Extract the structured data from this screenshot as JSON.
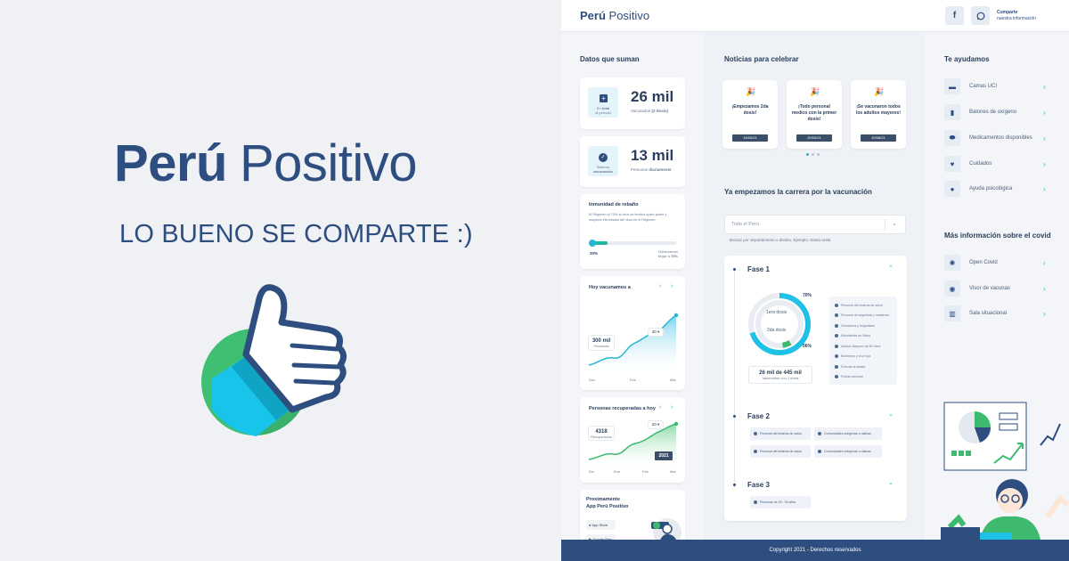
{
  "hero": {
    "title_bold": "Perú",
    "title_light": "Positivo",
    "subtitle": "LO BUENO SE COMPARTE :)"
  },
  "header": {
    "brand_bold": "Perú",
    "brand_light": "Positivo",
    "facebook_icon": "f",
    "share_line1": "Comparte",
    "share_line2": "nuestra información"
  },
  "datos": {
    "heading": "Datos que suman",
    "card1": {
      "icon_label_a": "En",
      "icon_label_b": "total",
      "icon_label_c": "al periodo",
      "number": "26 mil",
      "desc_a": "Vacunados",
      "desc_b": "(2 dosis)"
    },
    "card2": {
      "icon_label_a": "Sistema",
      "icon_label_b": "vacunación",
      "number": "13 mil",
      "desc_a": "Personas",
      "desc_b": "diariamente"
    },
    "immunity": {
      "title": "Inmunidad de rebaño",
      "text": "El Régimen al 70% al virus se tendría quien pobre y mayores efectividad del virus en el Régimen",
      "start": "20%",
      "goal_label": "Deberíamos llegar a",
      "goal": "70%",
      "progress": 0.2
    },
    "vacunados": {
      "title": "Hoy vacunamos a",
      "value": "300 mil",
      "value_label": "Personas",
      "tooltip": "30",
      "x": [
        "Dec",
        "Feb",
        "Mar"
      ]
    },
    "recuperados": {
      "title": "Personas recuperadas a hoy",
      "value": "4318",
      "value_label": "Recuperados",
      "tooltip": "20",
      "year": "2021",
      "x": [
        "Dic",
        "Ene",
        "Feb",
        "Mar"
      ]
    },
    "app": {
      "title_a": "Proximamente",
      "title_b": "App Perú Positivo",
      "appstore": "App Store",
      "googleplay": "Google Play"
    }
  },
  "noticias": {
    "heading": "Noticias para celebrar",
    "items": [
      {
        "text": "¡Empezamos 2da dosis!",
        "date": "14/03/21"
      },
      {
        "text": "¡Todo personal medico con la primer dosis!",
        "date": "20/03/21"
      },
      {
        "text": "¡Se vacunaron todos los adultos mayores!",
        "date": "10/08/21"
      }
    ]
  },
  "carrera": {
    "heading": "Ya empezamos la carrera por la vacunación",
    "select_value": "Todo el Perú",
    "hint": "Buscar por departamento o distrito. Ejemplo: Santa Anita",
    "fase1": {
      "title": "Fase 1",
      "ring_outer_label": "1era dosis",
      "ring_inner_label": "2da dosis",
      "pct_outer": "70%",
      "pct_inner": "06%",
      "outer_value": 0.7,
      "inner_value": 0.06,
      "total": "26 mil de 445 mil",
      "total_label": "Vacunados con 2 dosis",
      "legend": [
        "Personal del sistema de salud",
        "Personal de seguridad y mantenim.",
        "Voluntarios y brigadistas",
        "Estudiantes de Salud",
        "Adultos Mayores de 80 años",
        "Bomberos y cruz roja",
        "Fuerzas armadas",
        "Policía nacional"
      ]
    },
    "fase2": {
      "title": "Fase 2",
      "items": [
        "Personal del sistema de salud",
        "Comunidades indígenas o nativas",
        "Personal del sistema de salud",
        "Comunidades indígenas o nativas"
      ]
    },
    "fase3": {
      "title": "Fase 3",
      "items": [
        "Personas de 18 - 39 años"
      ]
    }
  },
  "ayudamos": {
    "heading": "Te ayudamos",
    "items": [
      "Camas UCI",
      "Balones de oxígeno",
      "Medicamentos disponibles",
      "Cuidados",
      "Ayuda psicológica"
    ]
  },
  "mas_info": {
    "heading": "Más información sobre el covid",
    "items": [
      "Open Covid",
      "Visor de vacunas",
      "Sala situacional"
    ]
  },
  "footer": {
    "text": "Copyright 2021 - Derechos reservados"
  },
  "colors": {
    "navy": "#2e4e80",
    "green": "#3dba6e",
    "cyan": "#1fc1e6",
    "background": "#f3f5f8"
  }
}
